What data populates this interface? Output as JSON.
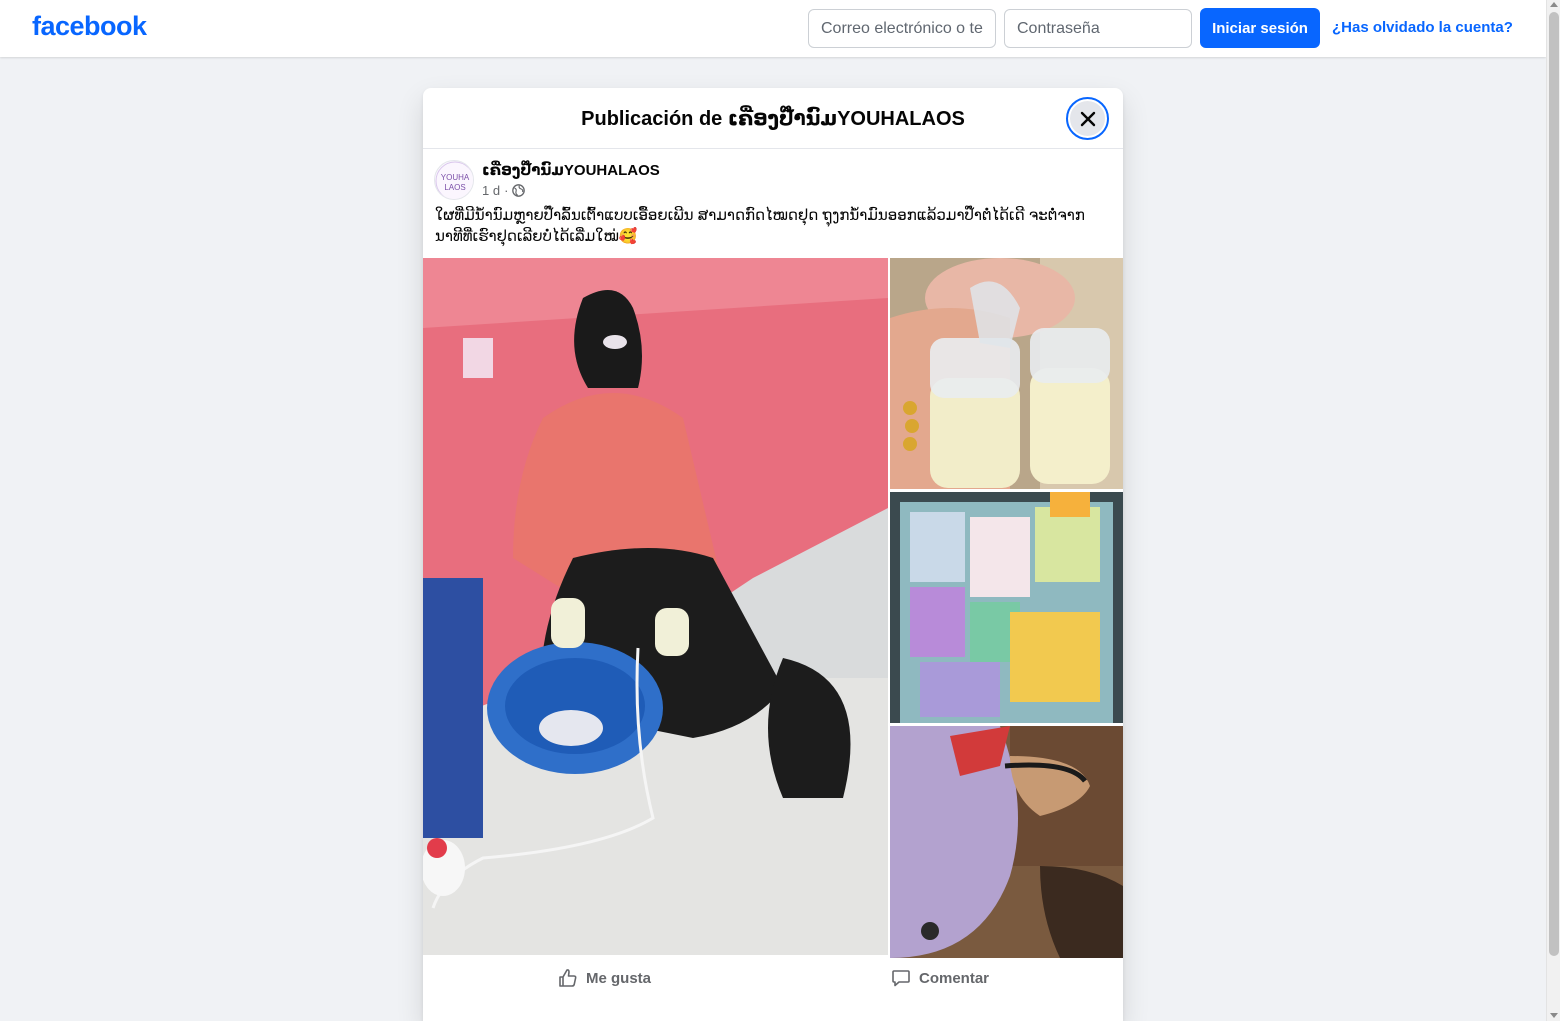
{
  "header": {
    "logo_text": "facebook",
    "email_placeholder": "Correo electrónico o teléfono",
    "password_placeholder": "Contraseña",
    "login_label": "Iniciar sesión",
    "forgot_label": "¿Has olvidado la cuenta?"
  },
  "dialog": {
    "title": "Publicación de ເຄື່ອງປ໊ຳນົມYOUHALAOS"
  },
  "post": {
    "author": "ເຄື່ອງປ໊ຳນົມYOUHALAOS",
    "avatar_text_line1": "YOUHA",
    "avatar_text_line2": "LAOS",
    "time": "1 d",
    "separator": "·",
    "audience_icon": "globe-icon",
    "text": "ໃຜທີ່ມີນ້ຳນົມຫຼາຍປ໊ຳລົ້ນເຕົ້າແບບເອື້ອຍເພີນ ສາມາດກົດໄໝດຢຸດ ຖຸງກນ້ຳມົນອອກແລ້ວມາປ໊ຳຕໍ່ໄດ້ເດີ ຈະຕໍ່ຈາກນາທີທີ່ເຮົາຢຸດເລີຍບໍ່ໄດ້ເລີ່ມໃໝ່🥰"
  },
  "actions": {
    "like_label": "Me gusta",
    "comment_label": "Comentar"
  },
  "colors": {
    "brand": "#0866ff",
    "background": "#f0f2f5",
    "secondary_text": "#65676b"
  }
}
